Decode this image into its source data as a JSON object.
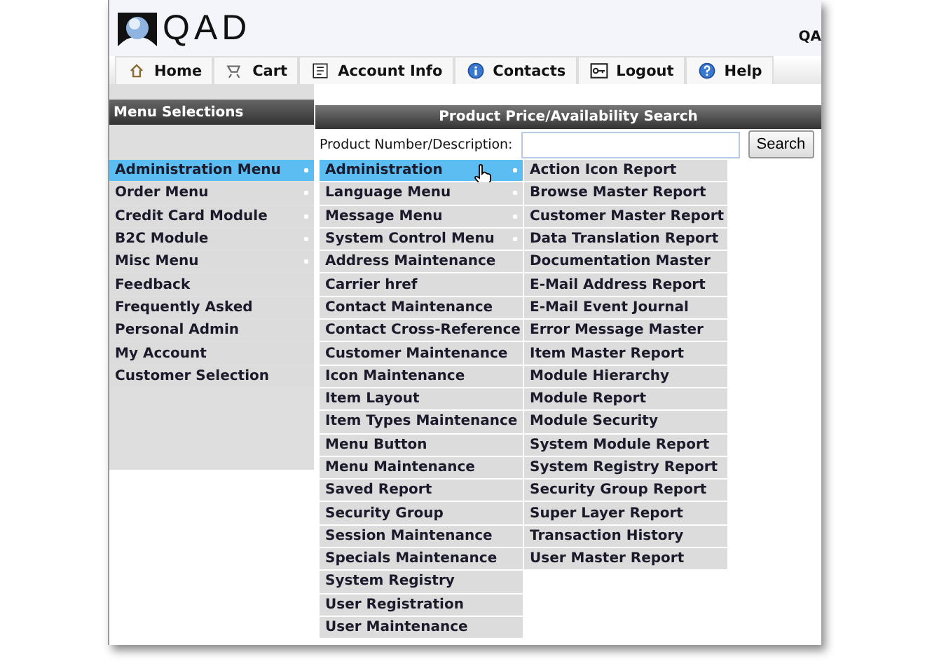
{
  "header": {
    "logo": "QAD",
    "user_text": "QA"
  },
  "nav": [
    {
      "label": "Home"
    },
    {
      "label": "Cart"
    },
    {
      "label": "Account Info"
    },
    {
      "label": "Contacts"
    },
    {
      "label": "Logout"
    },
    {
      "label": "Help"
    }
  ],
  "sidebar": {
    "title": "Menu Selections"
  },
  "search": {
    "title": "Product Price/Availability Search",
    "label": "Product Number/Description:",
    "button": "Search"
  },
  "menus": [
    {
      "items": [
        {
          "label": "Administration Menu",
          "has_submenu": true,
          "selected": true
        },
        {
          "label": "Order Menu",
          "has_submenu": true,
          "selected": false
        },
        {
          "label": "Credit Card Module",
          "has_submenu": true,
          "selected": false
        },
        {
          "label": "B2C Module",
          "has_submenu": true,
          "selected": false
        },
        {
          "label": "Misc Menu",
          "has_submenu": true,
          "selected": false
        },
        {
          "label": "Feedback",
          "has_submenu": false,
          "selected": false
        },
        {
          "label": "Frequently Asked",
          "has_submenu": false,
          "selected": false
        },
        {
          "label": "Personal Admin",
          "has_submenu": false,
          "selected": false
        },
        {
          "label": "My Account",
          "has_submenu": false,
          "selected": false
        },
        {
          "label": "Customer Selection",
          "has_submenu": false,
          "selected": false
        }
      ]
    },
    {
      "items": [
        {
          "label": "Administration",
          "has_submenu": true,
          "selected": true
        },
        {
          "label": "Language Menu",
          "has_submenu": true,
          "selected": false
        },
        {
          "label": "Message Menu",
          "has_submenu": true,
          "selected": false
        },
        {
          "label": "System Control Menu",
          "has_submenu": true,
          "selected": false
        },
        {
          "label": "Address Maintenance",
          "has_submenu": false,
          "selected": false
        },
        {
          "label": "Carrier href",
          "has_submenu": false,
          "selected": false
        },
        {
          "label": "Contact Maintenance",
          "has_submenu": false,
          "selected": false
        },
        {
          "label": "Contact Cross-Reference",
          "has_submenu": false,
          "selected": false
        },
        {
          "label": "Customer Maintenance",
          "has_submenu": false,
          "selected": false
        },
        {
          "label": "Icon Maintenance",
          "has_submenu": false,
          "selected": false
        },
        {
          "label": "Item Layout",
          "has_submenu": false,
          "selected": false
        },
        {
          "label": "Item Types Maintenance",
          "has_submenu": false,
          "selected": false
        },
        {
          "label": "Menu Button",
          "has_submenu": false,
          "selected": false
        },
        {
          "label": "Menu Maintenance",
          "has_submenu": false,
          "selected": false
        },
        {
          "label": "Saved Report",
          "has_submenu": false,
          "selected": false
        },
        {
          "label": "Security Group",
          "has_submenu": false,
          "selected": false
        },
        {
          "label": "Session Maintenance",
          "has_submenu": false,
          "selected": false
        },
        {
          "label": "Specials Maintenance",
          "has_submenu": false,
          "selected": false
        },
        {
          "label": "System Registry",
          "has_submenu": false,
          "selected": false
        },
        {
          "label": "User Registration",
          "has_submenu": false,
          "selected": false
        },
        {
          "label": "User Maintenance",
          "has_submenu": false,
          "selected": false
        }
      ]
    },
    {
      "items": [
        {
          "label": "Action Icon Report",
          "has_submenu": false,
          "selected": false
        },
        {
          "label": "Browse Master Report",
          "has_submenu": false,
          "selected": false
        },
        {
          "label": "Customer Master Report",
          "has_submenu": false,
          "selected": false
        },
        {
          "label": "Data Translation Report",
          "has_submenu": false,
          "selected": false
        },
        {
          "label": "Documentation Master",
          "has_submenu": false,
          "selected": false
        },
        {
          "label": "E-Mail Address Report",
          "has_submenu": false,
          "selected": false
        },
        {
          "label": "E-Mail Event Journal",
          "has_submenu": false,
          "selected": false
        },
        {
          "label": "Error Message Master",
          "has_submenu": false,
          "selected": false
        },
        {
          "label": "Item Master Report",
          "has_submenu": false,
          "selected": false
        },
        {
          "label": "Module Hierarchy",
          "has_submenu": false,
          "selected": false
        },
        {
          "label": "Module Report",
          "has_submenu": false,
          "selected": false
        },
        {
          "label": "Module Security",
          "has_submenu": false,
          "selected": false
        },
        {
          "label": "System Module Report",
          "has_submenu": false,
          "selected": false
        },
        {
          "label": "System Registry Report",
          "has_submenu": false,
          "selected": false
        },
        {
          "label": "Security Group Report",
          "has_submenu": false,
          "selected": false
        },
        {
          "label": "Super Layer Report",
          "has_submenu": false,
          "selected": false
        },
        {
          "label": "Transaction History",
          "has_submenu": false,
          "selected": false
        },
        {
          "label": "User Master Report",
          "has_submenu": false,
          "selected": false
        }
      ]
    }
  ]
}
